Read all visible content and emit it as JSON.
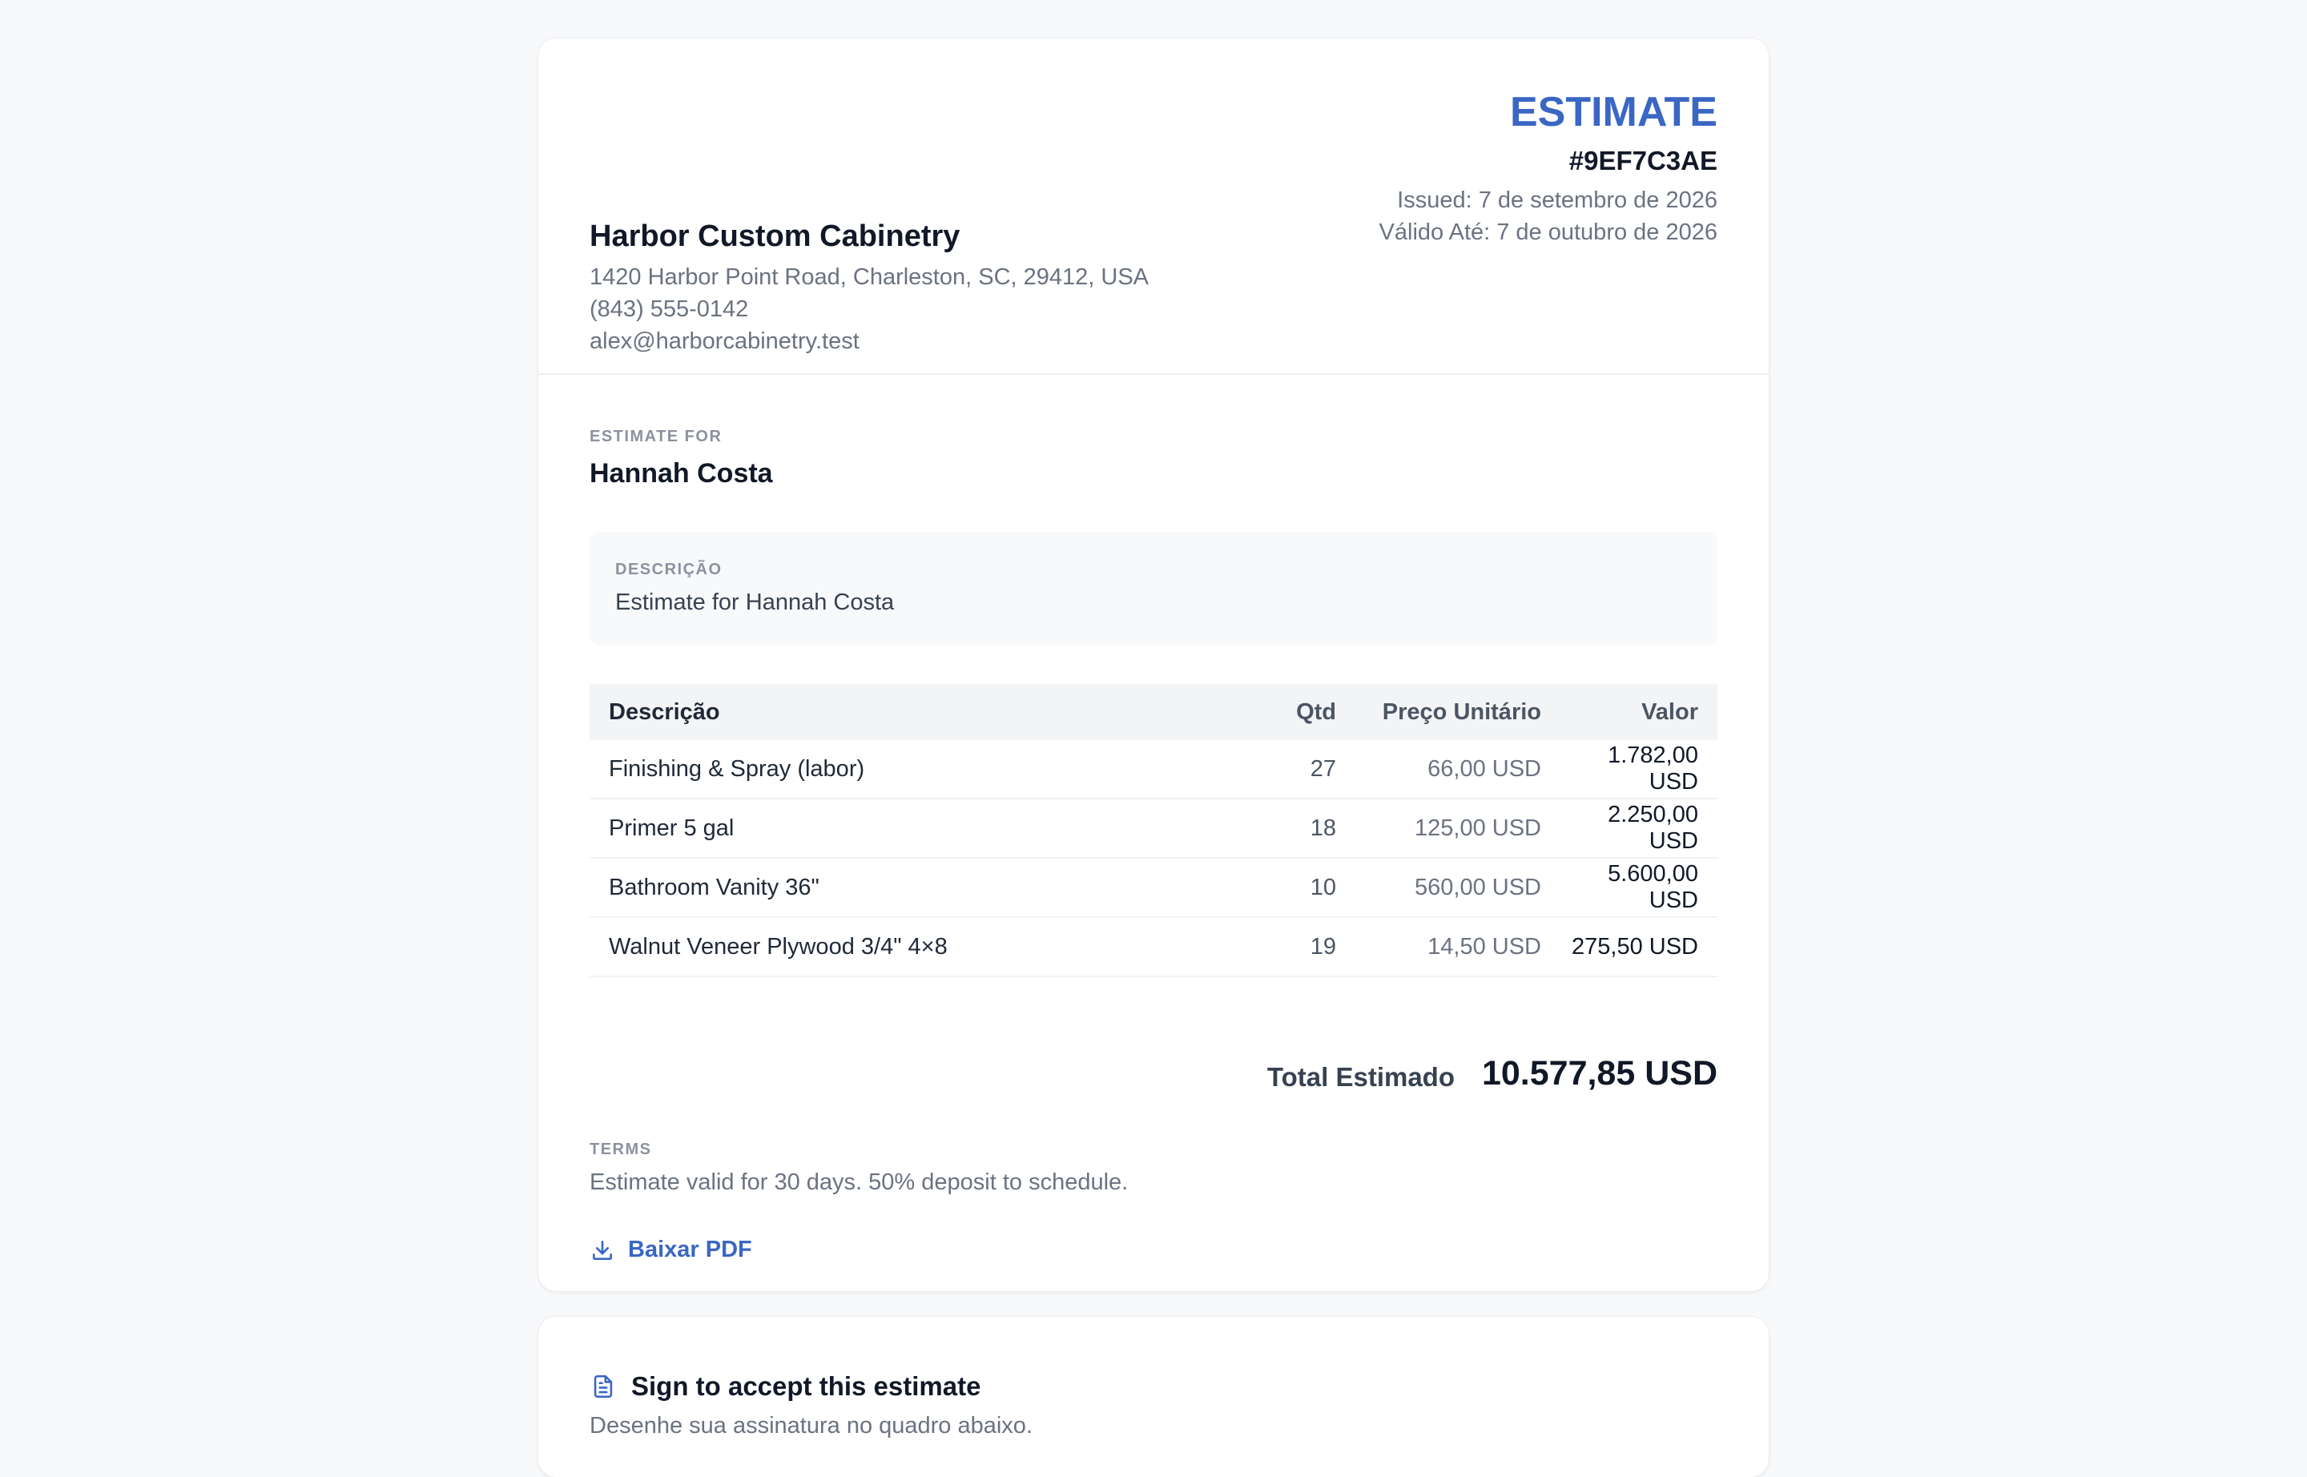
{
  "estimate": {
    "title": "ESTIMATE",
    "number": "#9EF7C3AE",
    "issued": "Issued: 7 de setembro de 2026",
    "valid_until": "Válido Até: 7 de outubro de 2026"
  },
  "business": {
    "name": "Harbor Custom Cabinetry",
    "address": "1420 Harbor Point Road, Charleston, SC, 29412, USA",
    "phone": "(843) 555-0142",
    "email": "alex@harborcabinetry.test"
  },
  "client": {
    "label": "ESTIMATE FOR",
    "name": "Hannah Costa"
  },
  "description": {
    "label": "DESCRIÇÃO",
    "text": "Estimate for Hannah Costa"
  },
  "table": {
    "headers": {
      "description": "Descrição",
      "qty": "Qtd",
      "unit_price": "Preço Unitário",
      "amount": "Valor"
    },
    "rows": [
      {
        "description": "Finishing & Spray (labor)",
        "qty": "27",
        "unit_price": "66,00 USD",
        "amount": "1.782,00 USD"
      },
      {
        "description": "Primer 5 gal",
        "qty": "18",
        "unit_price": "125,00 USD",
        "amount": "2.250,00 USD"
      },
      {
        "description": "Bathroom Vanity 36\"",
        "qty": "10",
        "unit_price": "560,00 USD",
        "amount": "5.600,00 USD"
      },
      {
        "description": "Walnut Veneer Plywood 3/4\" 4×8",
        "qty": "19",
        "unit_price": "14,50 USD",
        "amount": "275,50 USD"
      }
    ]
  },
  "total": {
    "label": "Total Estimado",
    "value": "10.577,85 USD"
  },
  "terms": {
    "label": "TERMS",
    "text": "Estimate valid for 30 days. 50% deposit to schedule."
  },
  "actions": {
    "download_pdf": "Baixar PDF",
    "download_icon": "download-icon"
  },
  "sign": {
    "title": "Sign to accept this estimate",
    "subtitle": "Desenhe sua assinatura no quadro abaixo.",
    "icon": "document-icon"
  },
  "colors": {
    "accent": "#3a66c4",
    "background": "#f8f9fb",
    "card": "#ffffff",
    "muted_text": "#6b7280"
  }
}
